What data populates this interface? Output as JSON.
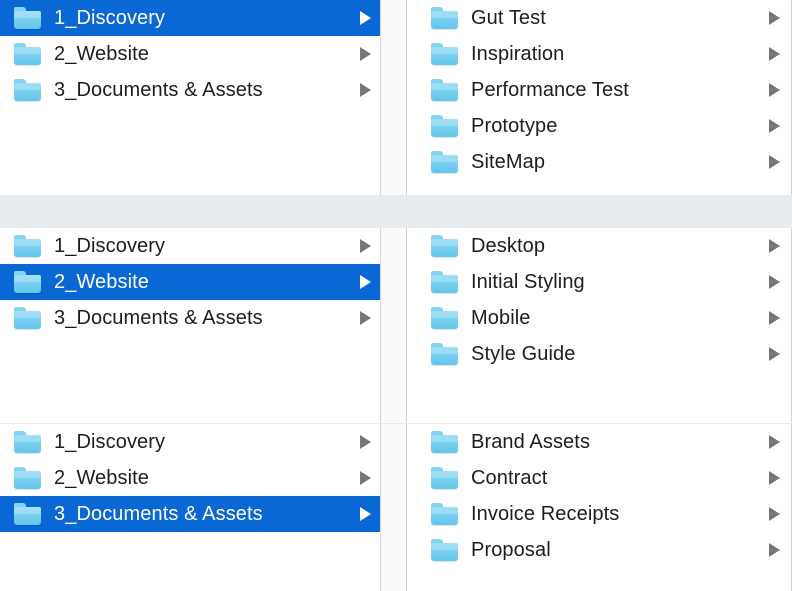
{
  "window": {
    "view_mode": "column-view",
    "icon_name": "folder-icon",
    "chevron_icon_name": "disclosure-triangle-icon"
  },
  "theme": {
    "selection_blue": "#0a68d4",
    "folder_blue": "#72cdf0",
    "band_gray": "#e7ebee",
    "text_color": "#1d1d1f",
    "selected_text_color": "#ffffff",
    "chevron_gray": "#767676",
    "pane_background": "#ffffff"
  },
  "sections": [
    {
      "id": "section-discovery",
      "left_column": {
        "name": "root-column",
        "items": [
          {
            "label": "1_Discovery",
            "selected": true
          },
          {
            "label": "2_Website",
            "selected": false
          },
          {
            "label": "3_Documents & Assets",
            "selected": false
          }
        ]
      },
      "right_column": {
        "name": "discovery-children-column",
        "items": [
          {
            "label": "Gut Test",
            "selected": false
          },
          {
            "label": "Inspiration",
            "selected": false
          },
          {
            "label": "Performance Test",
            "selected": false
          },
          {
            "label": "Prototype",
            "selected": false
          },
          {
            "label": "SiteMap",
            "selected": false
          }
        ]
      }
    },
    {
      "id": "section-website",
      "left_column": {
        "name": "root-column",
        "items": [
          {
            "label": "1_Discovery",
            "selected": false
          },
          {
            "label": "2_Website",
            "selected": true
          },
          {
            "label": "3_Documents & Assets",
            "selected": false
          }
        ]
      },
      "right_column": {
        "name": "website-children-column",
        "items": [
          {
            "label": "Desktop",
            "selected": false
          },
          {
            "label": "Initial Styling",
            "selected": false
          },
          {
            "label": "Mobile",
            "selected": false
          },
          {
            "label": "Style Guide",
            "selected": false
          }
        ]
      }
    },
    {
      "id": "section-documents-assets",
      "left_column": {
        "name": "root-column",
        "items": [
          {
            "label": "1_Discovery",
            "selected": false
          },
          {
            "label": "2_Website",
            "selected": false
          },
          {
            "label": "3_Documents & Assets",
            "selected": true
          }
        ]
      },
      "right_column": {
        "name": "documents-assets-children-column",
        "items": [
          {
            "label": "Brand Assets",
            "selected": false
          },
          {
            "label": "Contract",
            "selected": false
          },
          {
            "label": "Invoice Receipts",
            "selected": false
          },
          {
            "label": "Proposal",
            "selected": false
          }
        ]
      }
    }
  ]
}
